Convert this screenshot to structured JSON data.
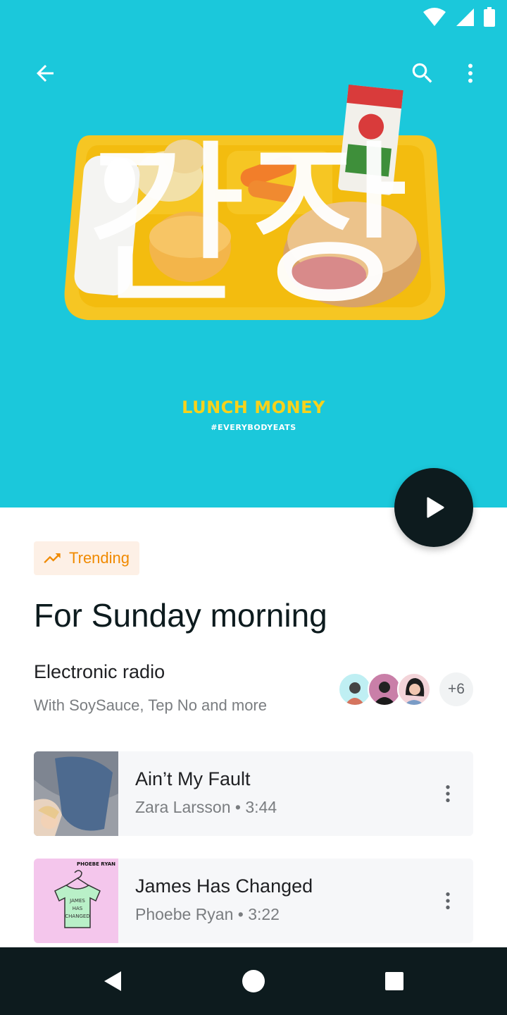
{
  "colors": {
    "hero_background": "#1bc8db",
    "accent_dark": "#0d1b1e",
    "trending": "#f08a00",
    "album_title": "#f7d21b"
  },
  "app_bar": {
    "back_icon": "arrow-back-icon",
    "search_icon": "search-icon",
    "more_icon": "more-vert-icon"
  },
  "hero": {
    "album_title": "LUNCH MONEY",
    "album_tag": "#EVERYBODYEATS",
    "hangul_text": "간장"
  },
  "play_button": {
    "icon": "play-icon"
  },
  "trending_chip": {
    "icon": "trending-up-icon",
    "label": "Trending"
  },
  "heading": "For Sunday morning",
  "radio": {
    "title": "Electronic radio",
    "subtitle": "With SoySauce, Tep No and more",
    "more_count": "+6"
  },
  "tracks": [
    {
      "title": "Ain’t My Fault",
      "meta": "Zara Larsson • 3:44"
    },
    {
      "title": "James Has Changed",
      "meta": "Phoebe Ryan • 3:22"
    }
  ],
  "thumb2": {
    "tag": "PHOEBE RYAN",
    "shirt_text_1": "JAMES",
    "shirt_text_2": "HAS",
    "shirt_text_3": "CHANGED"
  },
  "nav": {
    "back_icon": "nav-back-icon",
    "home_icon": "nav-home-icon",
    "recents_icon": "nav-recents-icon"
  }
}
